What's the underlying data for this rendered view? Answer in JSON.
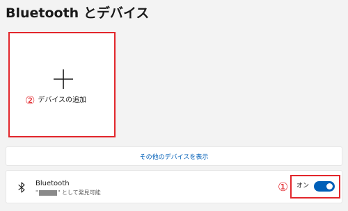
{
  "header": {
    "title": "Bluetooth とデバイス"
  },
  "add_tile": {
    "marker": "②",
    "label": "デバイスの追加",
    "plus_icon": "plus-icon"
  },
  "show_more": {
    "label": "その他のデバイスを表示"
  },
  "bluetooth": {
    "title": "Bluetooth",
    "subtitle_prefix": "\"",
    "subtitle_suffix": "\" として発見可能",
    "marker": "①",
    "toggle_label": "オン",
    "toggle_on": true,
    "icon": "bluetooth-icon"
  },
  "colors": {
    "highlight": "#e2262b",
    "accent": "#005fb8"
  }
}
